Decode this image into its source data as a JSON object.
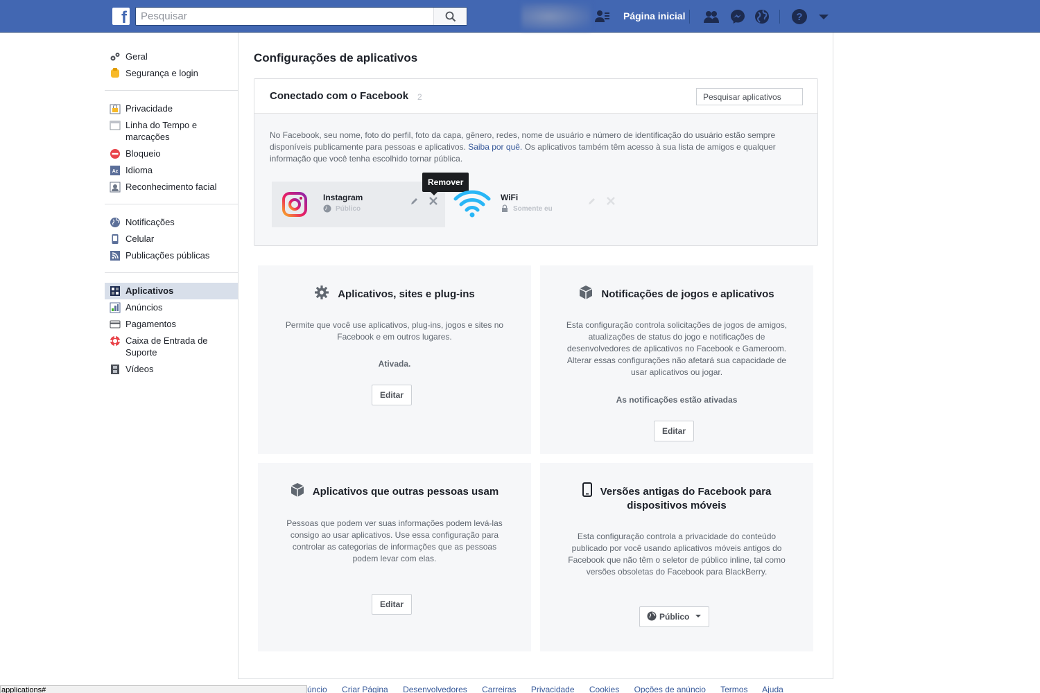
{
  "header": {
    "logo": "f",
    "search_placeholder": "Pesquisar",
    "home_label": "Página inicial"
  },
  "sidebar": {
    "groups": [
      [
        {
          "label": "Geral",
          "icon": "gears-icon"
        },
        {
          "label": "Segurança e login",
          "icon": "badge-icon"
        }
      ],
      [
        {
          "label": "Privacidade",
          "icon": "lock-icon"
        },
        {
          "label": "Linha do Tempo e marcações",
          "icon": "timeline-icon"
        },
        {
          "label": "Bloqueio",
          "icon": "block-icon"
        },
        {
          "label": "Idioma",
          "icon": "language-icon"
        },
        {
          "label": "Reconhecimento facial",
          "icon": "face-icon"
        }
      ],
      [
        {
          "label": "Notificações",
          "icon": "globe-icon"
        },
        {
          "label": "Celular",
          "icon": "phone-icon"
        },
        {
          "label": "Publicações públicas",
          "icon": "rss-icon"
        }
      ],
      [
        {
          "label": "Aplicativos",
          "icon": "apps-icon",
          "active": true
        },
        {
          "label": "Anúncios",
          "icon": "ads-icon"
        },
        {
          "label": "Pagamentos",
          "icon": "card-icon"
        },
        {
          "label": "Caixa de Entrada de Suporte",
          "icon": "lifebuoy-icon"
        },
        {
          "label": "Vídeos",
          "icon": "film-icon"
        }
      ]
    ]
  },
  "main": {
    "title": "Configurações de aplicativos",
    "connected": {
      "title": "Conectado com o Facebook",
      "count": "2",
      "search_placeholder": "Pesquisar aplicativos",
      "desc_1": "No Facebook, seu nome, foto do perfil, foto da capa, gênero, redes, nome de usuário e número de identificação do usuário estão sempre disponíveis publicamente para pessoas e aplicativos.",
      "desc_link": "Saiba por quê.",
      "desc_2": "Os aplicativos também têm acesso à sua lista de amigos e qualquer informação que você tenha escolhido tornar pública.",
      "tooltip": "Remover",
      "apps": [
        {
          "name": "Instagram",
          "audience": "Público"
        },
        {
          "name": "WiFi",
          "audience": "Somente eu"
        }
      ]
    },
    "panels": {
      "apps_sites": {
        "title": "Aplicativos, sites e plug-ins",
        "desc": "Permite que você use aplicativos, plug-ins, jogos e sites no Facebook e em outros lugares.",
        "status": "Ativada.",
        "button": "Editar"
      },
      "game_notifs": {
        "title": "Notificações de jogos e aplicativos",
        "desc": "Esta configuração controla solicitações de jogos de amigos, atualizações de status do jogo e notificações de desenvolvedores de aplicativos no Facebook e Gameroom. Alterar essas configurações não afetará sua capacidade de usar aplicativos ou jogar.",
        "status": "As notificações estão ativadas",
        "button": "Editar"
      },
      "others_apps": {
        "title": "Aplicativos que outras pessoas usam",
        "desc": "Pessoas que podem ver suas informações podem levá-las consigo ao usar aplicativos. Use essa configuração para controlar as categorias de informações que as pessoas podem levar com elas.",
        "button": "Editar"
      },
      "old_versions": {
        "title_1": "Versões antigas do Facebook para",
        "title_2": "dispositivos móveis",
        "desc": "Esta configuração controla a privacidade do conteúdo publicado por você usando aplicativos móveis antigos do Facebook que não têm o seletor de público inline, tal como versões obsoletas do Facebook para BlackBerry.",
        "button": "Público"
      }
    }
  },
  "footer": {
    "links": [
      "úncio",
      "Criar Página",
      "Desenvolvedores",
      "Carreiras",
      "Privacidade",
      "Cookies",
      "Opções de anúncio",
      "Termos",
      "Ajuda"
    ]
  },
  "status_bar": "applications#",
  "colors": {
    "brand": "#4267b2",
    "link": "#365899",
    "panel_bg": "#f6f7f9",
    "active_bg": "#d8dfea"
  }
}
